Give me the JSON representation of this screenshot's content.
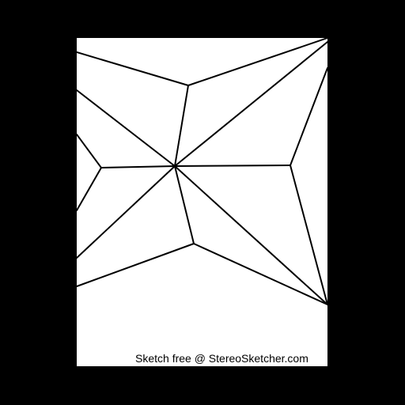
{
  "watermark": {
    "text": "Sketch free @ StereoSketcher.com"
  },
  "colors": {
    "background": "#000000",
    "sheet": "#ffffff",
    "line": "#000000"
  }
}
